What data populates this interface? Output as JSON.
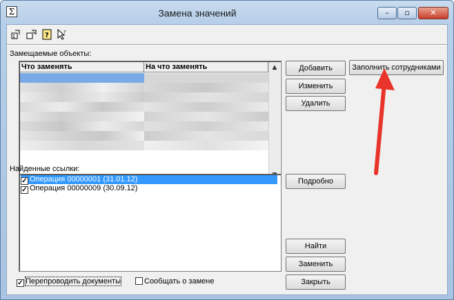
{
  "window": {
    "title": "Замена значений"
  },
  "caption_buttons": {
    "minimize": "–",
    "maximize": "▫",
    "close": "✕"
  },
  "toolbar": {
    "icons": [
      "replace-from-icon",
      "replace-to-icon",
      "help-icon",
      "pointer-help-icon"
    ]
  },
  "replaced_objects": {
    "label": "Замещаемые объекты:",
    "columns": [
      "Что заменять",
      "На что заменять"
    ],
    "rows_visible": 8
  },
  "found_refs": {
    "label": "Найденные ссылки:",
    "items": [
      {
        "text": "Операция 00000001 (31.01.12)",
        "checked": true,
        "selected": true
      },
      {
        "text": "Операция 00000009 (30.09.12)",
        "checked": true,
        "selected": false
      }
    ]
  },
  "buttons": {
    "add": "Добавить",
    "edit": "Изменить",
    "delete": "Удалить",
    "fill_employees": "Заполнить сотрудниками",
    "details": "Подробно",
    "find": "Найти",
    "replace": "Заменить",
    "close": "Закрыть"
  },
  "options": {
    "repost": {
      "label": "Перепроводить документы",
      "checked": true
    },
    "notify": {
      "label": "Сообщать о замене",
      "checked": false
    }
  },
  "colors": {
    "selection": "#3399ff",
    "arrow": "#e8342a"
  }
}
